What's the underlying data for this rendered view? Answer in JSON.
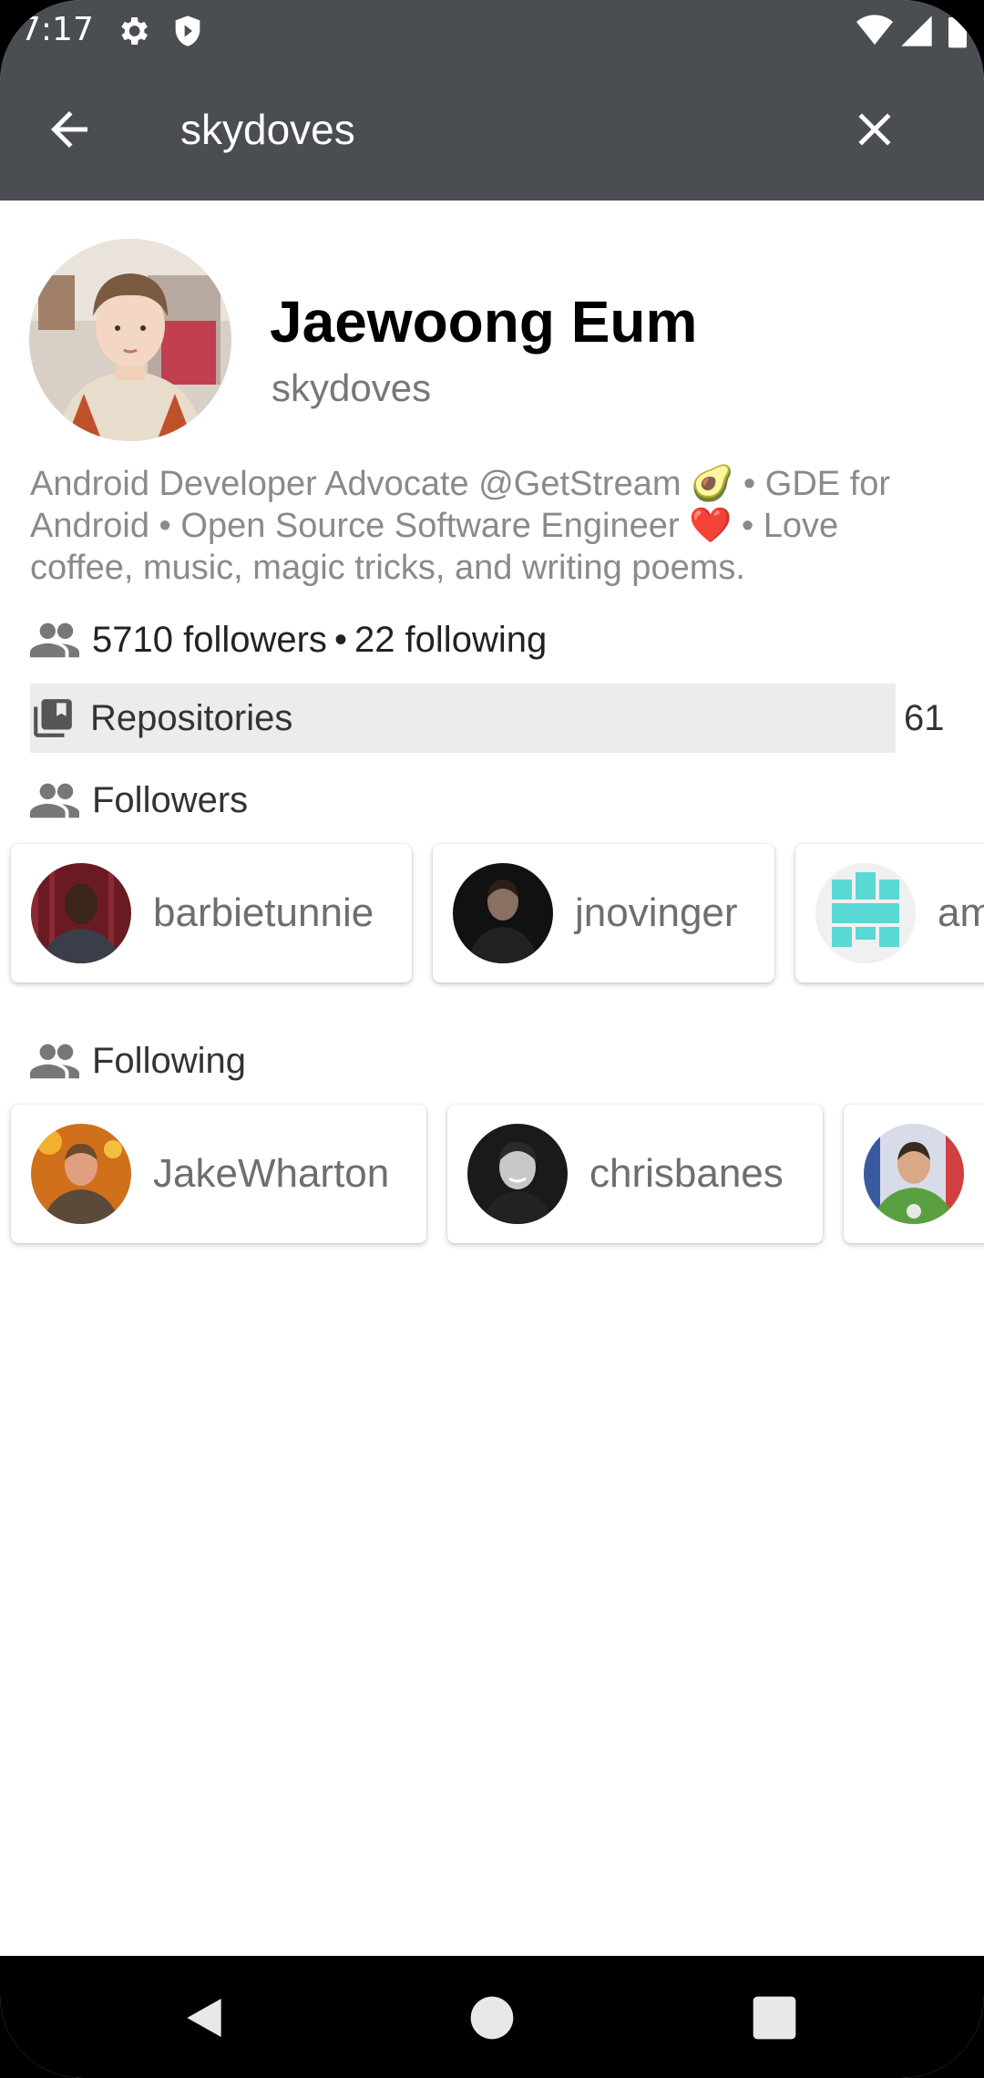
{
  "status_bar": {
    "time": "7:17"
  },
  "app_bar": {
    "query": "skydoves"
  },
  "profile": {
    "name": "Jaewoong Eum",
    "login": "skydoves",
    "bio": "Android Developer Advocate @GetStream 🥑 • GDE for Android • Open Source Software Engineer ❤️  • Love coffee, music, magic tricks, and writing poems.",
    "followers_text": "5710 followers",
    "separator": "•",
    "following_text": "22 following"
  },
  "repositories": {
    "label": "Repositories",
    "count": "61"
  },
  "followers_section": {
    "title": "Followers",
    "items": [
      {
        "login": "barbietunnie"
      },
      {
        "login": "jnovinger"
      },
      {
        "login": "am"
      }
    ]
  },
  "following_section": {
    "title": "Following",
    "items": [
      {
        "login": "JakeWharton"
      },
      {
        "login": "chrisbanes"
      },
      {
        "login": ""
      }
    ]
  },
  "colors": {
    "app_bar": "#4a4d52",
    "repo_row_bg": "#ececec",
    "secondary_text": "#8a8a8a",
    "identicon": "#5ad8d4"
  }
}
